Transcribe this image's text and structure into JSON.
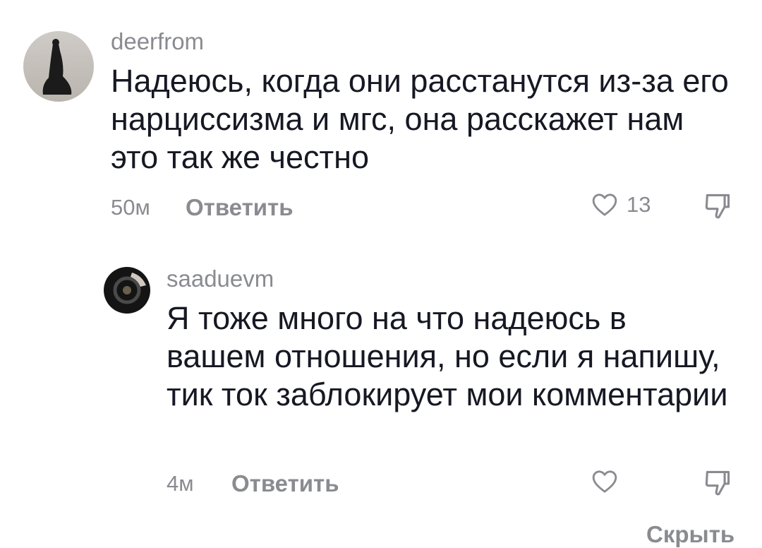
{
  "comments": [
    {
      "username": "deerfrom",
      "text": "Надеюсь, когда они расстанутся из-за его нарциссизма и мгс, она расскажет нам это так же честно",
      "time": "50м",
      "reply_label": "Ответить",
      "likes": "13",
      "avatar_icon": "user-avatar-photo"
    },
    {
      "username": "saaduevm",
      "text": "Я тоже много на что надеюсь в вашем отношения, но если я напишу, тик ток заблокирует мои комментарии",
      "time": "4м",
      "reply_label": "Ответить",
      "likes": "",
      "avatar_icon": "user-avatar-photo"
    }
  ],
  "footer": {
    "hide_label": "Скрыть"
  },
  "icons": {
    "like": "heart-outline-icon",
    "dislike": "thumbs-down-icon"
  },
  "colors": {
    "text": "#161823",
    "muted": "#8a8b91",
    "background": "#ffffff"
  }
}
